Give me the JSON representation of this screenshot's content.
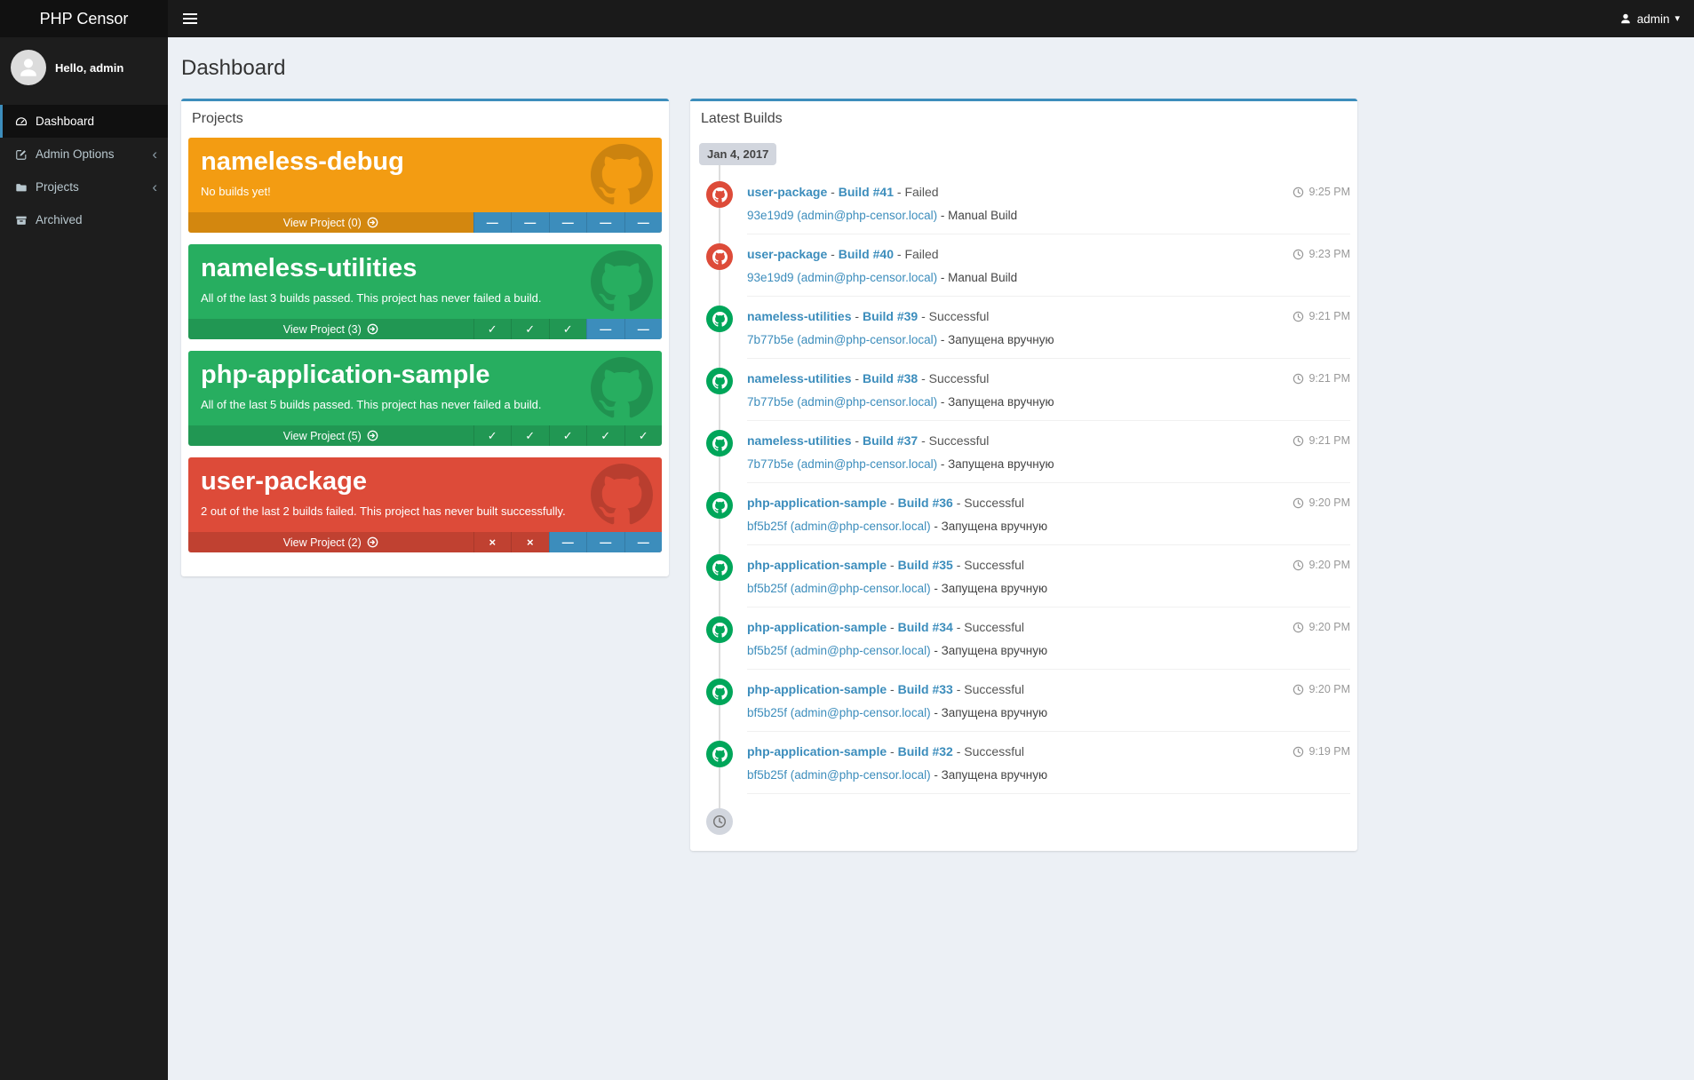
{
  "brand": "PHP Censor",
  "icons": {
    "caret_down": "▾",
    "chevron_left": "‹"
  },
  "topbar": {
    "user": "admin"
  },
  "sidebar": {
    "greeting": "Hello, admin",
    "items": [
      {
        "label": "Dashboard"
      },
      {
        "label": "Admin Options"
      },
      {
        "label": "Projects"
      },
      {
        "label": "Archived"
      }
    ]
  },
  "page_title": "Dashboard",
  "status_glyphs": {
    "ok": "✓",
    "fail": "×",
    "none": "—"
  },
  "colors": {
    "accent": "#3c8dbc",
    "link": "#3c8dbc",
    "status_none": "#3c8dbc",
    "icon_success": "#00a65a",
    "icon_danger": "#dd4b39",
    "warning_card": "#f39c12",
    "success_card": "#27ae60",
    "danger_card": "#dd4b39"
  },
  "projects_panel": {
    "title": "Projects",
    "cards": [
      {
        "name": "nameless-debug",
        "message": "No builds yet!",
        "footer_label": "View Project (0)",
        "color": "#f39c12",
        "statuses": [
          "none",
          "none",
          "none",
          "none",
          "none"
        ]
      },
      {
        "name": "nameless-utilities",
        "message": "All of the last 3 builds passed. This project has never failed a build.",
        "footer_label": "View Project (3)",
        "color": "#27ae60",
        "statuses": [
          "ok",
          "ok",
          "ok",
          "none",
          "none"
        ]
      },
      {
        "name": "php-application-sample",
        "message": "All of the last 5 builds passed. This project has never failed a build.",
        "footer_label": "View Project (5)",
        "color": "#27ae60",
        "statuses": [
          "ok",
          "ok",
          "ok",
          "ok",
          "ok"
        ]
      },
      {
        "name": "user-package",
        "message": "2 out of the last 2 builds failed. This project has never built successfully.",
        "footer_label": "View Project (2)",
        "color": "#dd4b39",
        "statuses": [
          "fail",
          "fail",
          "none",
          "none",
          "none"
        ]
      }
    ]
  },
  "builds_panel": {
    "title": "Latest Builds",
    "date_label": "Jan 4, 2017",
    "separator": " - ",
    "builds": [
      {
        "project": "user-package",
        "build": "Build #41",
        "status": "Failed",
        "ok": false,
        "commit": "93e19d9 (admin@php-censor.local)",
        "note": "Manual Build",
        "time": "9:25 PM"
      },
      {
        "project": "user-package",
        "build": "Build #40",
        "status": "Failed",
        "ok": false,
        "commit": "93e19d9 (admin@php-censor.local)",
        "note": "Manual Build",
        "time": "9:23 PM"
      },
      {
        "project": "nameless-utilities",
        "build": "Build #39",
        "status": "Successful",
        "ok": true,
        "commit": "7b77b5e (admin@php-censor.local)",
        "note": "Запущена вручную",
        "time": "9:21 PM"
      },
      {
        "project": "nameless-utilities",
        "build": "Build #38",
        "status": "Successful",
        "ok": true,
        "commit": "7b77b5e (admin@php-censor.local)",
        "note": "Запущена вручную",
        "time": "9:21 PM"
      },
      {
        "project": "nameless-utilities",
        "build": "Build #37",
        "status": "Successful",
        "ok": true,
        "commit": "7b77b5e (admin@php-censor.local)",
        "note": "Запущена вручную",
        "time": "9:21 PM"
      },
      {
        "project": "php-application-sample",
        "build": "Build #36",
        "status": "Successful",
        "ok": true,
        "commit": "bf5b25f (admin@php-censor.local)",
        "note": "Запущена вручную",
        "time": "9:20 PM"
      },
      {
        "project": "php-application-sample",
        "build": "Build #35",
        "status": "Successful",
        "ok": true,
        "commit": "bf5b25f (admin@php-censor.local)",
        "note": "Запущена вручную",
        "time": "9:20 PM"
      },
      {
        "project": "php-application-sample",
        "build": "Build #34",
        "status": "Successful",
        "ok": true,
        "commit": "bf5b25f (admin@php-censor.local)",
        "note": "Запущена вручную",
        "time": "9:20 PM"
      },
      {
        "project": "php-application-sample",
        "build": "Build #33",
        "status": "Successful",
        "ok": true,
        "commit": "bf5b25f (admin@php-censor.local)",
        "note": "Запущена вручную",
        "time": "9:20 PM"
      },
      {
        "project": "php-application-sample",
        "build": "Build #32",
        "status": "Successful",
        "ok": true,
        "commit": "bf5b25f (admin@php-censor.local)",
        "note": "Запущена вручную",
        "time": "9:19 PM"
      }
    ]
  }
}
